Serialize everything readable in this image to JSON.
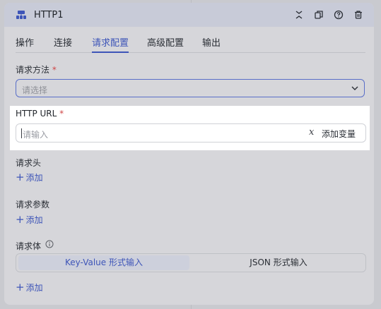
{
  "node": {
    "title": "HTTP1"
  },
  "tabs": [
    "操作",
    "连接",
    "请求配置",
    "高级配置",
    "输出"
  ],
  "request_method": {
    "label": "请求方法",
    "required_mark": "*",
    "placeholder": "请选择"
  },
  "http_url": {
    "label": "HTTP URL",
    "required_mark": "*",
    "placeholder": "请输入",
    "add_variable_label": "添加变量"
  },
  "headers": {
    "label": "请求头",
    "add_label": "添加"
  },
  "params": {
    "label": "请求参数",
    "add_label": "添加"
  },
  "body": {
    "label": "请求体",
    "modes": [
      "Key-Value 形式输入",
      "JSON 形式输入"
    ],
    "selected_mode": "Key-Value 形式输入",
    "add_label": "添加"
  },
  "icons": [
    "node-icon",
    "collapse-icon",
    "copy-icon",
    "help-icon",
    "delete-icon",
    "chevron-down-icon",
    "variable-icon",
    "plus-icon",
    "info-icon"
  ],
  "colors": {
    "accent": "#3e55b8",
    "required": "#d04646"
  }
}
